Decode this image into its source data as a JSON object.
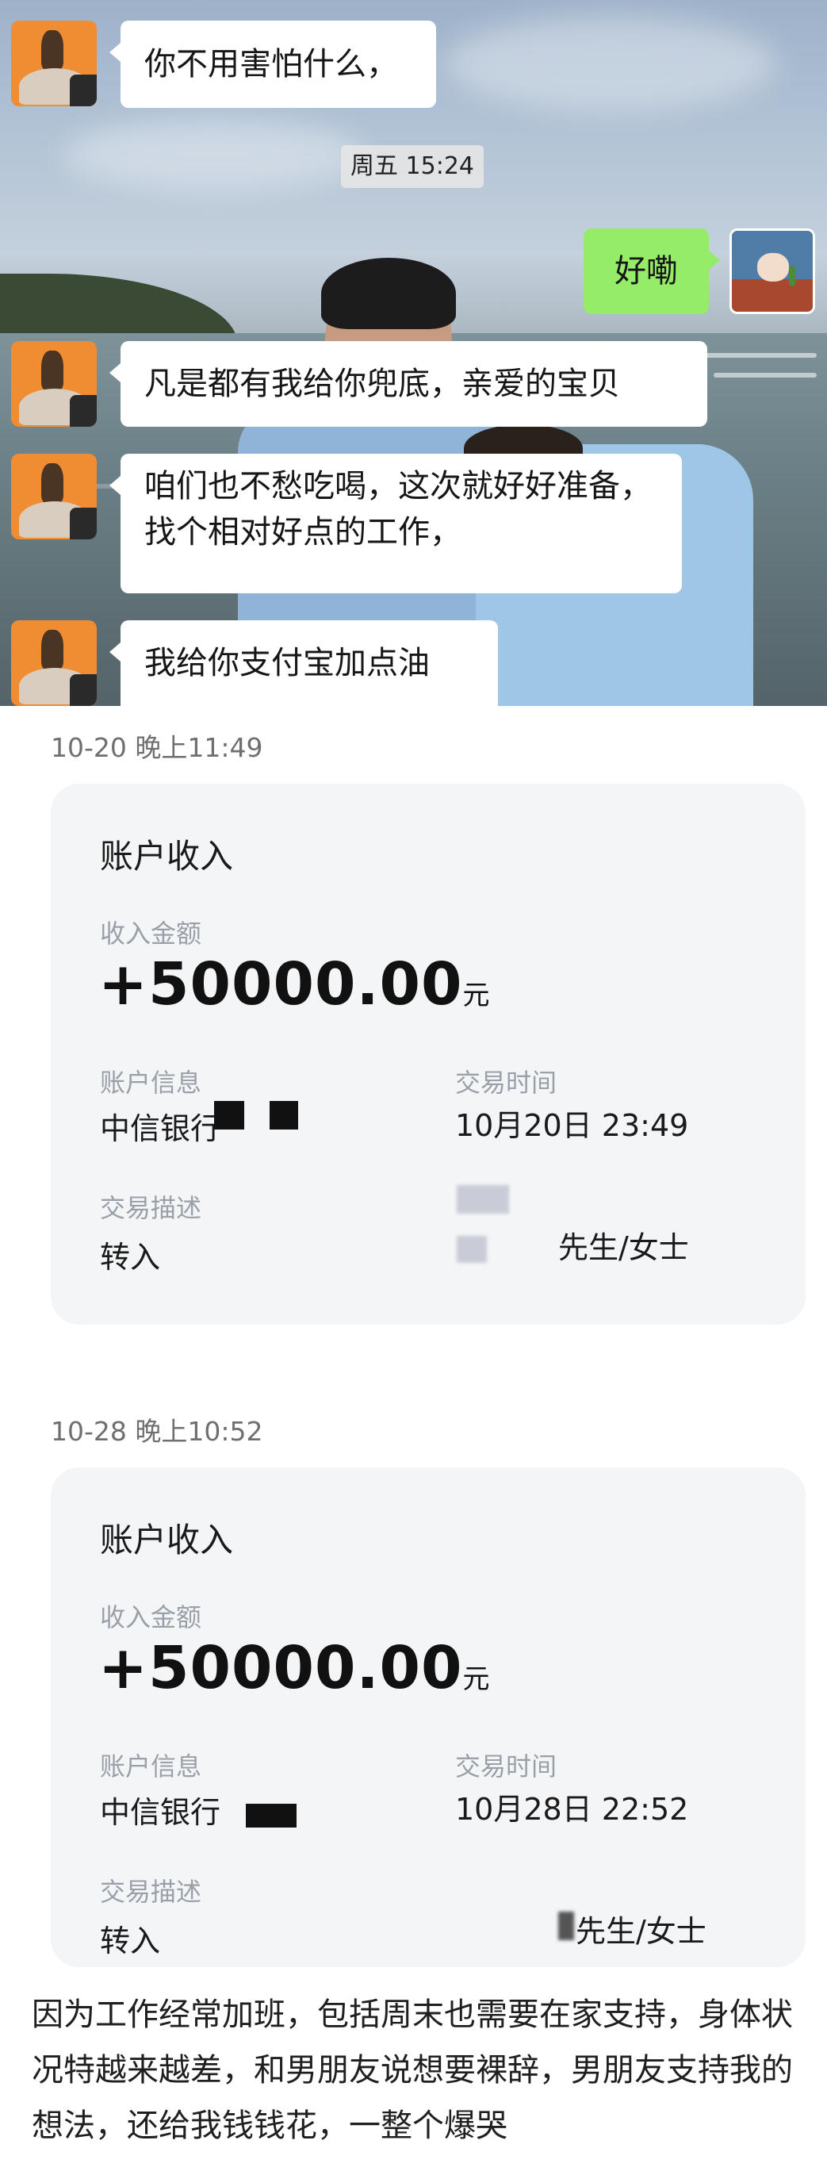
{
  "chat": {
    "messages": [
      {
        "side": "left",
        "text": "你不用害怕什么，"
      },
      {
        "side": "right",
        "text": "好嘞"
      },
      {
        "side": "left",
        "text": "凡是都有我给你兜底，亲爱的宝贝"
      },
      {
        "side": "left",
        "text": "咱们也不愁吃喝，这次就好好准备，找个相对好点的工作，"
      },
      {
        "side": "left",
        "text": "我给你支付宝加点油"
      }
    ],
    "time_chip": "周五 15:24"
  },
  "records": [
    {
      "time": "10-20 晚上11:49",
      "title": "账户收入",
      "amount_label": "收入金额",
      "amount": "+50000.00",
      "unit": "元",
      "account_label": "账户信息",
      "account_value": "中信银行",
      "trade_time_label": "交易时间",
      "trade_time_value": "10月20日 23:49",
      "desc_label": "交易描述",
      "desc_value": "转入",
      "counterparty": "先生/女士"
    },
    {
      "time": "10-28 晚上10:52",
      "title": "账户收入",
      "amount_label": "收入金额",
      "amount": "+50000.00",
      "unit": "元",
      "account_label": "账户信息",
      "account_value": "中信银行",
      "trade_time_label": "交易时间",
      "trade_time_value": "10月28日 22:52",
      "desc_label": "交易描述",
      "desc_value": "转入",
      "counterparty": "先生/女士"
    }
  ],
  "caption": "因为工作经常加班，包括周末也需要在家支持，身体状况特越来越差，和男朋友说想要裸辞，男朋友支持我的想法，还给我钱钱花，一整个爆哭"
}
